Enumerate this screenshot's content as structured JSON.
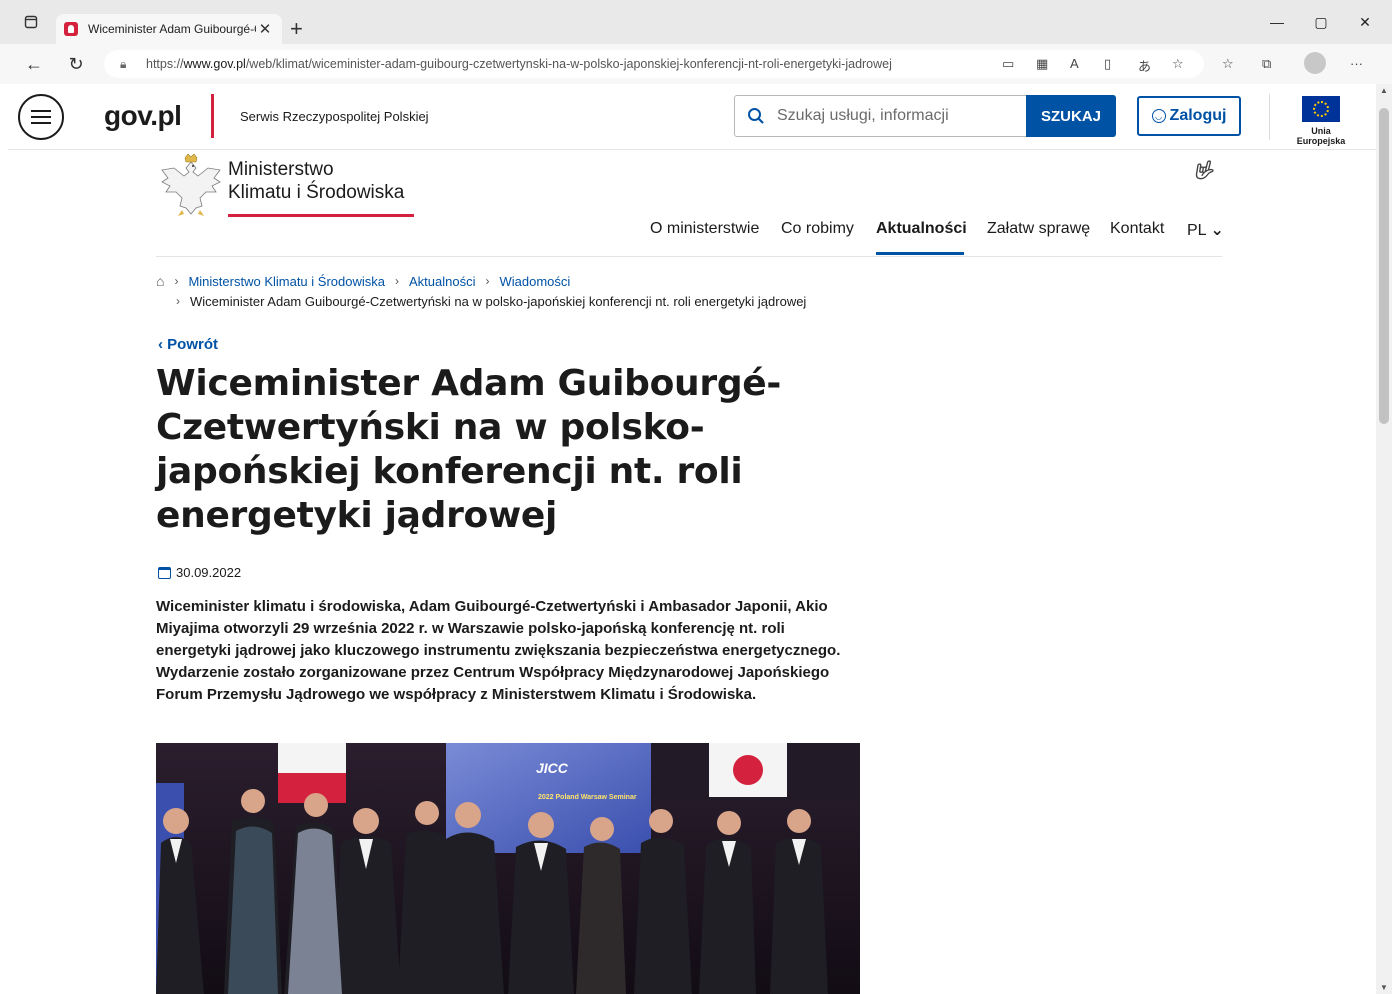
{
  "browser": {
    "tab_title": "Wiceminister Adam Guibourgé-C",
    "url_prefix": "https://",
    "url_host": "www.gov.pl",
    "url_path": "/web/klimat/wiceminister-adam-guibourg-czetwertynski-na-w-polsko-japonskiej-konferencji-nt-roli-energetyki-jadrowej"
  },
  "header": {
    "logo": "gov.pl",
    "service": "Serwis Rzeczypospolitej Polskiej",
    "search_placeholder": "Szukaj usługi, informacji",
    "search_button": "SZUKAJ",
    "login": "Zaloguj",
    "eu_label": "Unia Europejska"
  },
  "ministry": {
    "line1": "Ministerstwo",
    "line2": "Klimatu i Środowiska"
  },
  "nav": [
    {
      "label": "O ministerstwie"
    },
    {
      "label": "Co robimy"
    },
    {
      "label": "Aktualności"
    },
    {
      "label": "Załatw sprawę"
    },
    {
      "label": "Kontakt"
    },
    {
      "label": "PL"
    }
  ],
  "breadcrumbs": {
    "items": [
      "Ministerstwo Klimatu i Środowiska",
      "Aktualności",
      "Wiadomości"
    ],
    "current": "Wiceminister Adam Guibourgé-Czetwertyński na w polsko-japońskiej konferencji nt. roli energetyki jądrowej"
  },
  "article": {
    "back": "Powrót",
    "title": "Wiceminister Adam Guibourgé-Czetwertyński na w polsko-japońskiej konferencji nt. roli energetyki jądrowej",
    "date": "30.09.2022",
    "lead": "Wiceminister klimatu i środowiska, Adam Guibourgé-Czetwertyński i Ambasador Japonii, Akio Miyajima otworzyli 29 września 2022 r. w Warszawie polsko-japońską konferencję nt. roli energetyki jądrowej jako kluczowego instrumentu zwiększania bezpieczeństwa energetycznego. Wydarzenie zostało zorganizowane przez Centrum Współpracy Międzynarodowej Japońskiego Forum Przemysłu Jądrowego we współpracy z Ministerstwem Klimatu i Środowiska.",
    "photo_banner_text": "JICC",
    "photo_banner_sub": "2022 Poland Warsaw Seminar"
  },
  "colors": {
    "gov_blue": "#0052a5",
    "gov_red": "#d4213d"
  }
}
